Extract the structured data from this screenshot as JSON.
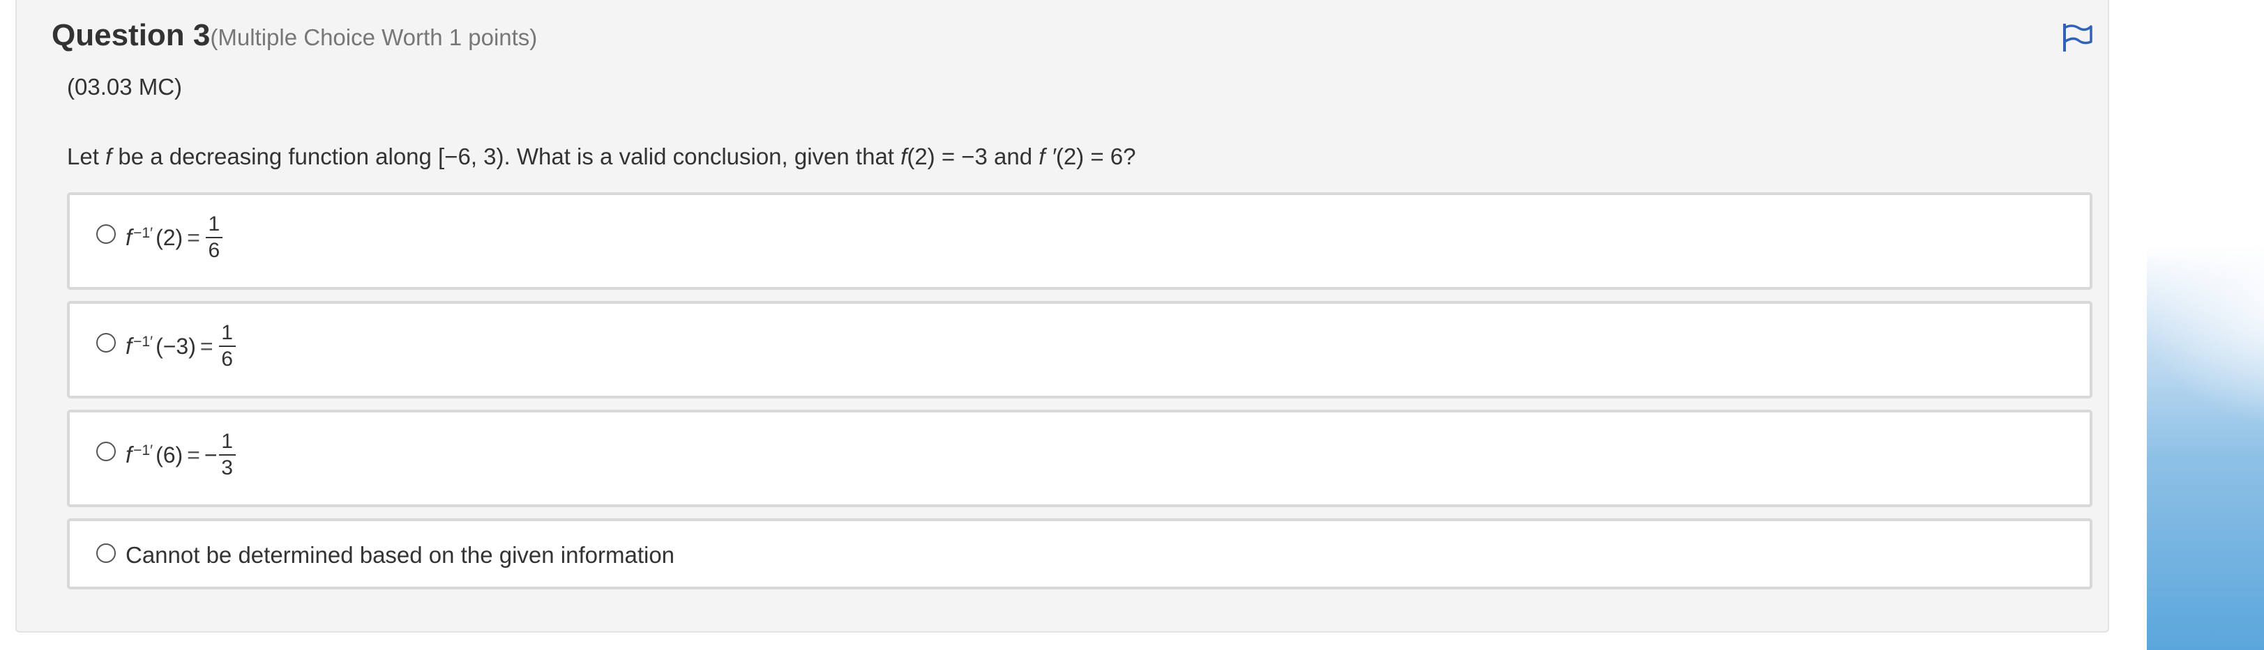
{
  "question": {
    "title": "Question 3",
    "meta": "(Multiple Choice Worth 1 points)",
    "code": "(03.03 MC)",
    "stem": {
      "p1": "Let ",
      "f": "f",
      "p2": " be a decreasing function along [−6, 3). What is a valid conclusion, given that ",
      "f_call": "f",
      "p3": "(2) = −3 and ",
      "fprime": "f ′",
      "p4": "(2) = 6?"
    },
    "flag_icon": "flag-icon"
  },
  "choices": [
    {
      "f": "f",
      "sup": "−1′",
      "arg": "(2)",
      "eq": "=",
      "sign": "",
      "num": "1",
      "den": "6"
    },
    {
      "f": "f",
      "sup": "−1′",
      "arg": "(−3)",
      "eq": "=",
      "sign": "",
      "num": "1",
      "den": "6"
    },
    {
      "f": "f",
      "sup": "−1′",
      "arg": "(6)",
      "eq": "=",
      "sign": "−",
      "num": "1",
      "den": "3"
    },
    {
      "text": "Cannot be determined based on the given information"
    }
  ]
}
